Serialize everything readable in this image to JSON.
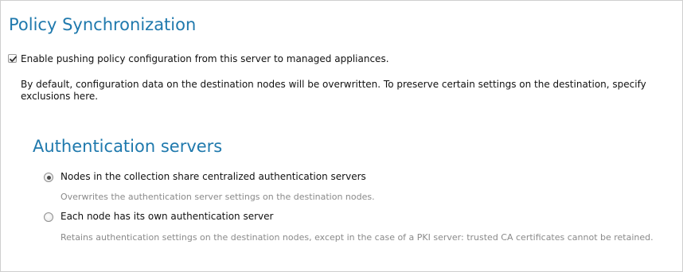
{
  "section": {
    "title": "Policy Synchronization"
  },
  "enable_push": {
    "checked": true,
    "label": "Enable pushing policy configuration from this server to managed appliances."
  },
  "description": "By default, configuration data on the destination nodes will be overwritten. To preserve certain settings on the destination, specify exclusions here.",
  "auth_servers": {
    "title": "Authentication servers",
    "options": [
      {
        "label": "Nodes in the collection share centralized authentication servers",
        "description": "Overwrites the authentication server settings on the destination nodes.",
        "selected": true
      },
      {
        "label": "Each node has its own authentication server",
        "description": "Retains authentication settings on the destination nodes, except in the case of a PKI server: trusted CA certificates cannot be retained.",
        "selected": false
      }
    ]
  },
  "colors": {
    "heading": "#1f79ad",
    "text": "#111111",
    "muted": "#8a8a8a",
    "border": "#cfcfcf"
  }
}
